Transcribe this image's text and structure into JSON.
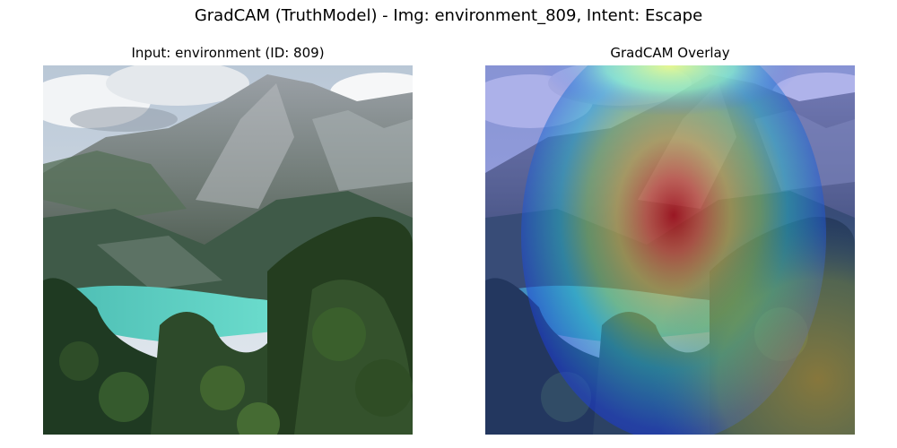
{
  "figure": {
    "title": "GradCAM (TruthModel) - Img: environment_809, Intent: Escape"
  },
  "panels": [
    {
      "title": "Input: environment (ID: 809)",
      "image": "mountain-lake-photo"
    },
    {
      "title": "GradCAM Overlay",
      "image": "gradcam-heatmap-overlay"
    }
  ]
}
